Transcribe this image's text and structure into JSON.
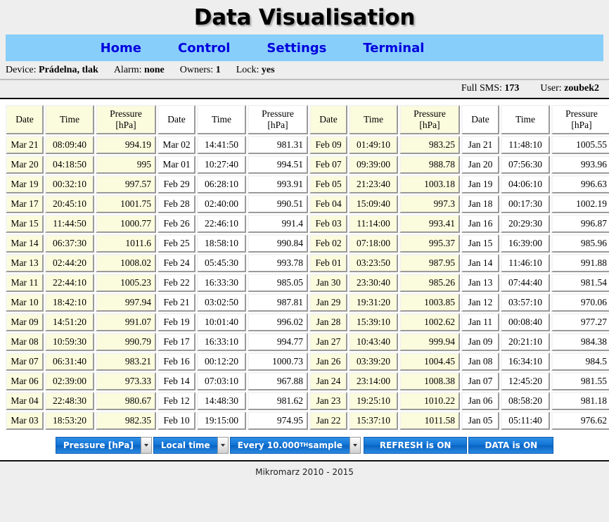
{
  "header": {
    "title": "Data Visualisation"
  },
  "nav": {
    "items": [
      {
        "label": "Home"
      },
      {
        "label": "Control"
      },
      {
        "label": "Settings"
      },
      {
        "label": "Terminal"
      }
    ]
  },
  "device_info": {
    "device_label": "Device:",
    "device_value": "Prádelna, tlak",
    "alarm_label": "Alarm:",
    "alarm_value": "none",
    "owners_label": "Owners:",
    "owners_value": "1",
    "lock_label": "Lock:",
    "lock_value": "yes"
  },
  "status_bar": {
    "full_sms_label": "Full SMS:",
    "full_sms_value": "173",
    "user_label": "User:",
    "user_value": "zoubek2"
  },
  "table": {
    "headers": {
      "date": "Date",
      "time": "Time",
      "pressure_line1": "Pressure",
      "pressure_line2": "[hPa]"
    },
    "groups": [
      {
        "tint": "yellow",
        "rows": [
          {
            "date": "Mar 21",
            "time": "08:09:40",
            "pressure": "994.19"
          },
          {
            "date": "Mar 20",
            "time": "04:18:50",
            "pressure": "995"
          },
          {
            "date": "Mar 19",
            "time": "00:32:10",
            "pressure": "997.57"
          },
          {
            "date": "Mar 17",
            "time": "20:45:10",
            "pressure": "1001.75"
          },
          {
            "date": "Mar 15",
            "time": "11:44:50",
            "pressure": "1000.77"
          },
          {
            "date": "Mar 14",
            "time": "06:37:30",
            "pressure": "1011.6"
          },
          {
            "date": "Mar 13",
            "time": "02:44:20",
            "pressure": "1008.02"
          },
          {
            "date": "Mar 11",
            "time": "22:44:10",
            "pressure": "1005.23"
          },
          {
            "date": "Mar 10",
            "time": "18:42:10",
            "pressure": "997.94"
          },
          {
            "date": "Mar 09",
            "time": "14:51:20",
            "pressure": "991.07"
          },
          {
            "date": "Mar 08",
            "time": "10:59:30",
            "pressure": "990.79"
          },
          {
            "date": "Mar 07",
            "time": "06:31:40",
            "pressure": "983.21"
          },
          {
            "date": "Mar 06",
            "time": "02:39:00",
            "pressure": "973.33"
          },
          {
            "date": "Mar 04",
            "time": "22:48:30",
            "pressure": "980.67"
          },
          {
            "date": "Mar 03",
            "time": "18:53:20",
            "pressure": "982.35"
          }
        ]
      },
      {
        "tint": "white",
        "rows": [
          {
            "date": "Mar 02",
            "time": "14:41:50",
            "pressure": "981.31"
          },
          {
            "date": "Mar 01",
            "time": "10:27:40",
            "pressure": "994.51"
          },
          {
            "date": "Feb 29",
            "time": "06:28:10",
            "pressure": "993.91"
          },
          {
            "date": "Feb 28",
            "time": "02:40:00",
            "pressure": "990.51"
          },
          {
            "date": "Feb 26",
            "time": "22:46:10",
            "pressure": "991.4"
          },
          {
            "date": "Feb 25",
            "time": "18:58:10",
            "pressure": "990.84"
          },
          {
            "date": "Feb 24",
            "time": "05:45:30",
            "pressure": "993.78"
          },
          {
            "date": "Feb 22",
            "time": "16:33:30",
            "pressure": "985.05"
          },
          {
            "date": "Feb 21",
            "time": "03:02:50",
            "pressure": "987.81"
          },
          {
            "date": "Feb 19",
            "time": "10:01:40",
            "pressure": "996.02"
          },
          {
            "date": "Feb 17",
            "time": "16:33:10",
            "pressure": "994.77"
          },
          {
            "date": "Feb 16",
            "time": "00:12:20",
            "pressure": "1000.73"
          },
          {
            "date": "Feb 14",
            "time": "07:03:10",
            "pressure": "967.88"
          },
          {
            "date": "Feb 12",
            "time": "14:48:30",
            "pressure": "981.62"
          },
          {
            "date": "Feb 10",
            "time": "19:15:00",
            "pressure": "974.95"
          }
        ]
      },
      {
        "tint": "yellow",
        "rows": [
          {
            "date": "Feb 09",
            "time": "01:49:10",
            "pressure": "983.25"
          },
          {
            "date": "Feb 07",
            "time": "09:39:00",
            "pressure": "988.78"
          },
          {
            "date": "Feb 05",
            "time": "21:23:40",
            "pressure": "1003.18"
          },
          {
            "date": "Feb 04",
            "time": "15:09:40",
            "pressure": "997.3"
          },
          {
            "date": "Feb 03",
            "time": "11:14:00",
            "pressure": "993.41"
          },
          {
            "date": "Feb 02",
            "time": "07:18:00",
            "pressure": "995.37"
          },
          {
            "date": "Feb 01",
            "time": "03:23:50",
            "pressure": "987.95"
          },
          {
            "date": "Jan 30",
            "time": "23:30:40",
            "pressure": "985.26"
          },
          {
            "date": "Jan 29",
            "time": "19:31:20",
            "pressure": "1003.85"
          },
          {
            "date": "Jan 28",
            "time": "15:39:10",
            "pressure": "1002.62"
          },
          {
            "date": "Jan 27",
            "time": "10:43:40",
            "pressure": "999.94"
          },
          {
            "date": "Jan 26",
            "time": "03:39:20",
            "pressure": "1004.45"
          },
          {
            "date": "Jan 24",
            "time": "23:14:00",
            "pressure": "1008.38"
          },
          {
            "date": "Jan 23",
            "time": "19:25:10",
            "pressure": "1010.22"
          },
          {
            "date": "Jan 22",
            "time": "15:37:10",
            "pressure": "1011.58"
          }
        ]
      },
      {
        "tint": "white",
        "rows": [
          {
            "date": "Jan 21",
            "time": "11:48:10",
            "pressure": "1005.55"
          },
          {
            "date": "Jan 20",
            "time": "07:56:30",
            "pressure": "993.96"
          },
          {
            "date": "Jan 19",
            "time": "04:06:10",
            "pressure": "996.63"
          },
          {
            "date": "Jan 18",
            "time": "00:17:30",
            "pressure": "1002.19"
          },
          {
            "date": "Jan 16",
            "time": "20:29:30",
            "pressure": "996.87"
          },
          {
            "date": "Jan 15",
            "time": "16:39:00",
            "pressure": "985.96"
          },
          {
            "date": "Jan 14",
            "time": "11:46:10",
            "pressure": "991.88"
          },
          {
            "date": "Jan 13",
            "time": "07:44:40",
            "pressure": "981.54"
          },
          {
            "date": "Jan 12",
            "time": "03:57:10",
            "pressure": "970.06"
          },
          {
            "date": "Jan 11",
            "time": "00:08:40",
            "pressure": "977.27"
          },
          {
            "date": "Jan 09",
            "time": "20:21:10",
            "pressure": "984.38"
          },
          {
            "date": "Jan 08",
            "time": "16:34:10",
            "pressure": "984.5"
          },
          {
            "date": "Jan 07",
            "time": "12:45:20",
            "pressure": "981.55"
          },
          {
            "date": "Jan 06",
            "time": "08:58:20",
            "pressure": "981.18"
          },
          {
            "date": "Jan 05",
            "time": "05:11:40",
            "pressure": "976.62"
          }
        ]
      }
    ]
  },
  "controls": {
    "quantity_select": "Pressure [hPa]",
    "time_select": "Local time",
    "sample_select_pre": "Every 10.000",
    "sample_select_sup": "TH",
    "sample_select_post": " sample",
    "refresh_button": "REFRESH is ON",
    "data_button": "DATA is ON"
  },
  "footer": {
    "text": "Mikromarz 2010 - 2015"
  },
  "colors": {
    "nav_background": "#87CEFA",
    "nav_link": "#0000DD",
    "button_blue": "#1173D4",
    "cell_tint": "#FBFBDD",
    "page_band": "#EEEEEE"
  }
}
